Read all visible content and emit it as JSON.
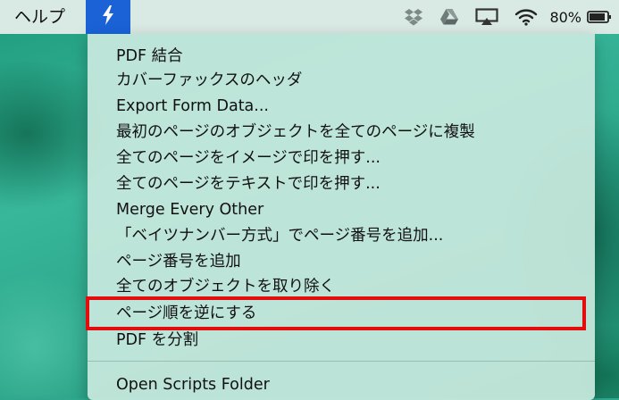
{
  "menubar": {
    "help_label": "ヘルプ",
    "battery_percent": "80%",
    "status_icons": [
      "dropbox-icon",
      "google-drive-icon",
      "airplay-icon",
      "wifi-icon",
      "battery-icon"
    ],
    "script_menu_icon": "script-bolt-icon",
    "accent_color": "#1a62d6"
  },
  "menu": {
    "items": [
      {
        "label": "PDF 結合"
      },
      {
        "label": "カバーファックスのヘッダ"
      },
      {
        "label": "Export Form Data..."
      },
      {
        "label": "最初のページのオブジェクトを全てのページに複製"
      },
      {
        "label": "全てのページをイメージで印を押す..."
      },
      {
        "label": "全てのページをテキストで印を押す..."
      },
      {
        "label": "Merge Every Other"
      },
      {
        "label": "「ベイツナンバー方式」でページ番号を追加..."
      },
      {
        "label": "ページ番号を追加"
      },
      {
        "label": "全てのオブジェクトを取り除く"
      },
      {
        "label": "ページ順を逆にする",
        "highlighted": true
      },
      {
        "label": "PDF を分割"
      }
    ],
    "footer_item": {
      "label": "Open Scripts Folder"
    }
  },
  "highlight_color": "#e30d0d"
}
